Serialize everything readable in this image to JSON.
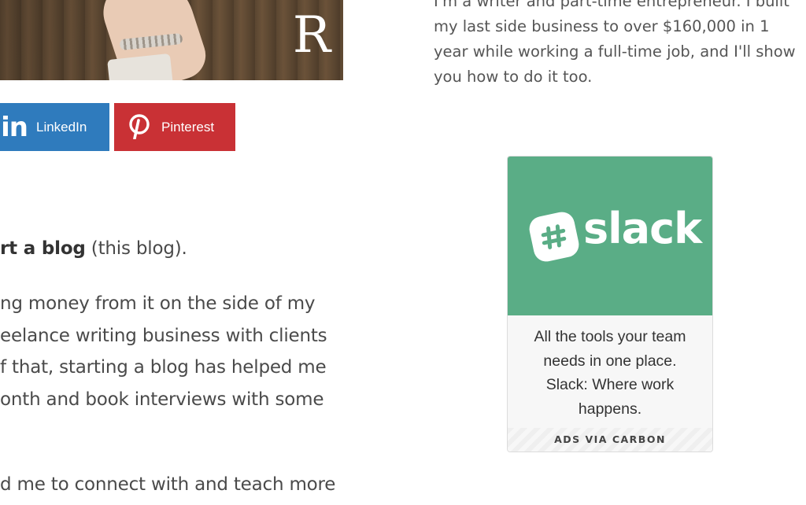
{
  "hero": {
    "logo_letter": "R"
  },
  "share": {
    "linkedin": {
      "icon": "in",
      "label": "LinkedIn",
      "color": "#2f7bbd"
    },
    "pinterest": {
      "label": "Pinterest",
      "color": "#c93135"
    }
  },
  "article": {
    "p1": {
      "bold": "rt a blog",
      "rest": " (this blog)."
    },
    "p2_lines": [
      "ng money from it on the side of my",
      "eelance writing business with clients",
      "f that, starting a blog has helped me",
      "onth and book interviews with some"
    ],
    "p3_line": "d me to connect with and teach more"
  },
  "bio": {
    "lines": [
      "I'm a writer and part-time entrepreneur. I built",
      "my last side business to over $160,000 in 1",
      "year while working a full-time job, and I'll show",
      "you how to do it too."
    ]
  },
  "ad": {
    "brand": "slack",
    "brand_color": "#5aad86",
    "text_lines": [
      "All the tools your team",
      "needs in one place.",
      "Slack: Where work",
      "happens."
    ],
    "via": "ADS VIA CARBON"
  }
}
